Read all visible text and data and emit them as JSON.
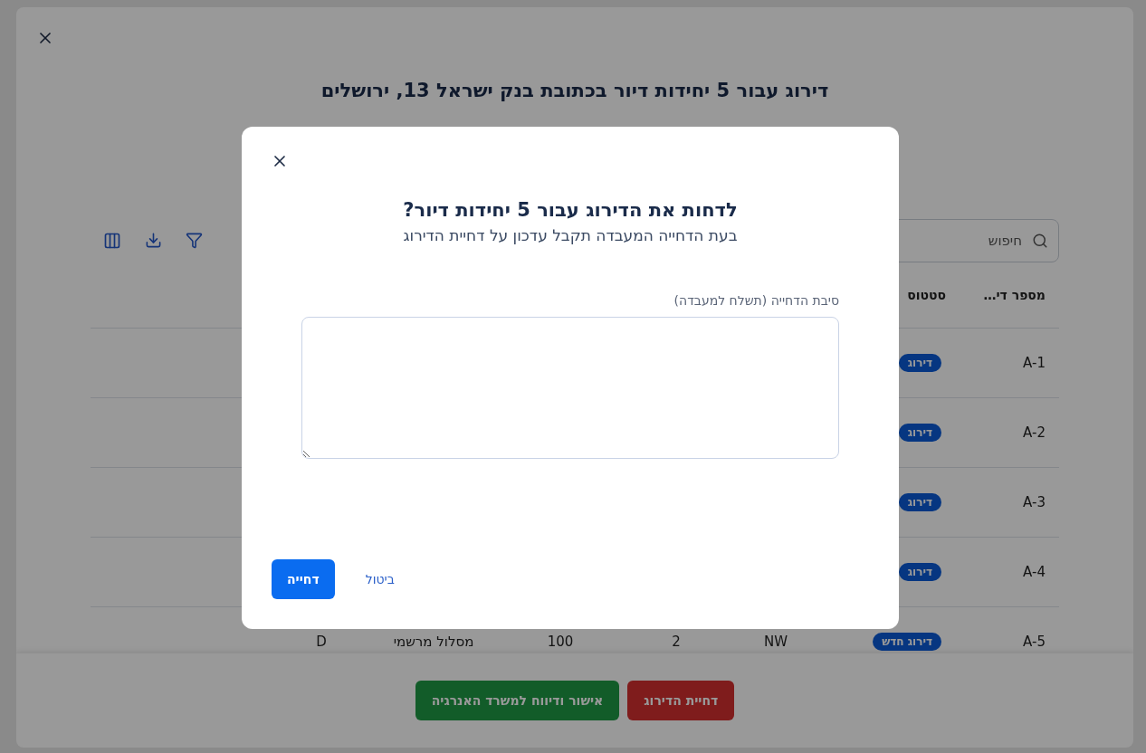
{
  "page": {
    "title": "דירוג עבור 5 יחידות דיור בכתובת בנק ישראל 13, ירושלים",
    "search": {
      "placeholder": "חיפוש"
    },
    "table": {
      "columns": [
        "מספר די…",
        "סטטוס"
      ],
      "rows": [
        {
          "id": "A-1",
          "status": "דירוג"
        },
        {
          "id": "A-2",
          "status": "דירוג"
        },
        {
          "id": "A-3",
          "status": "דירוג"
        },
        {
          "id": "A-4",
          "status": "דירוג"
        },
        {
          "id": "A-5",
          "status": "דירוג חדש",
          "cells": [
            "NW",
            "2",
            "100",
            "מסלול מרשמי",
            "D"
          ]
        }
      ]
    },
    "footer_buttons": [
      {
        "label": "דחיית הדירוג",
        "kind": "danger"
      },
      {
        "label": "אישור ודיווח למשרד האנרגיה",
        "kind": "success"
      }
    ]
  },
  "dialog": {
    "title": "לדחות את הדירוג עבור 5 יחידות דיור?",
    "subtitle": "בעת הדחייה המעבדה תקבל עדכון על דחיית הדירוג",
    "field_label": "סיבת הדחייה (תשלח למעבדה)",
    "buttons": [
      {
        "label": "ביטול",
        "kind": "link"
      },
      {
        "label": "דחייה",
        "kind": "primary"
      }
    ]
  }
}
